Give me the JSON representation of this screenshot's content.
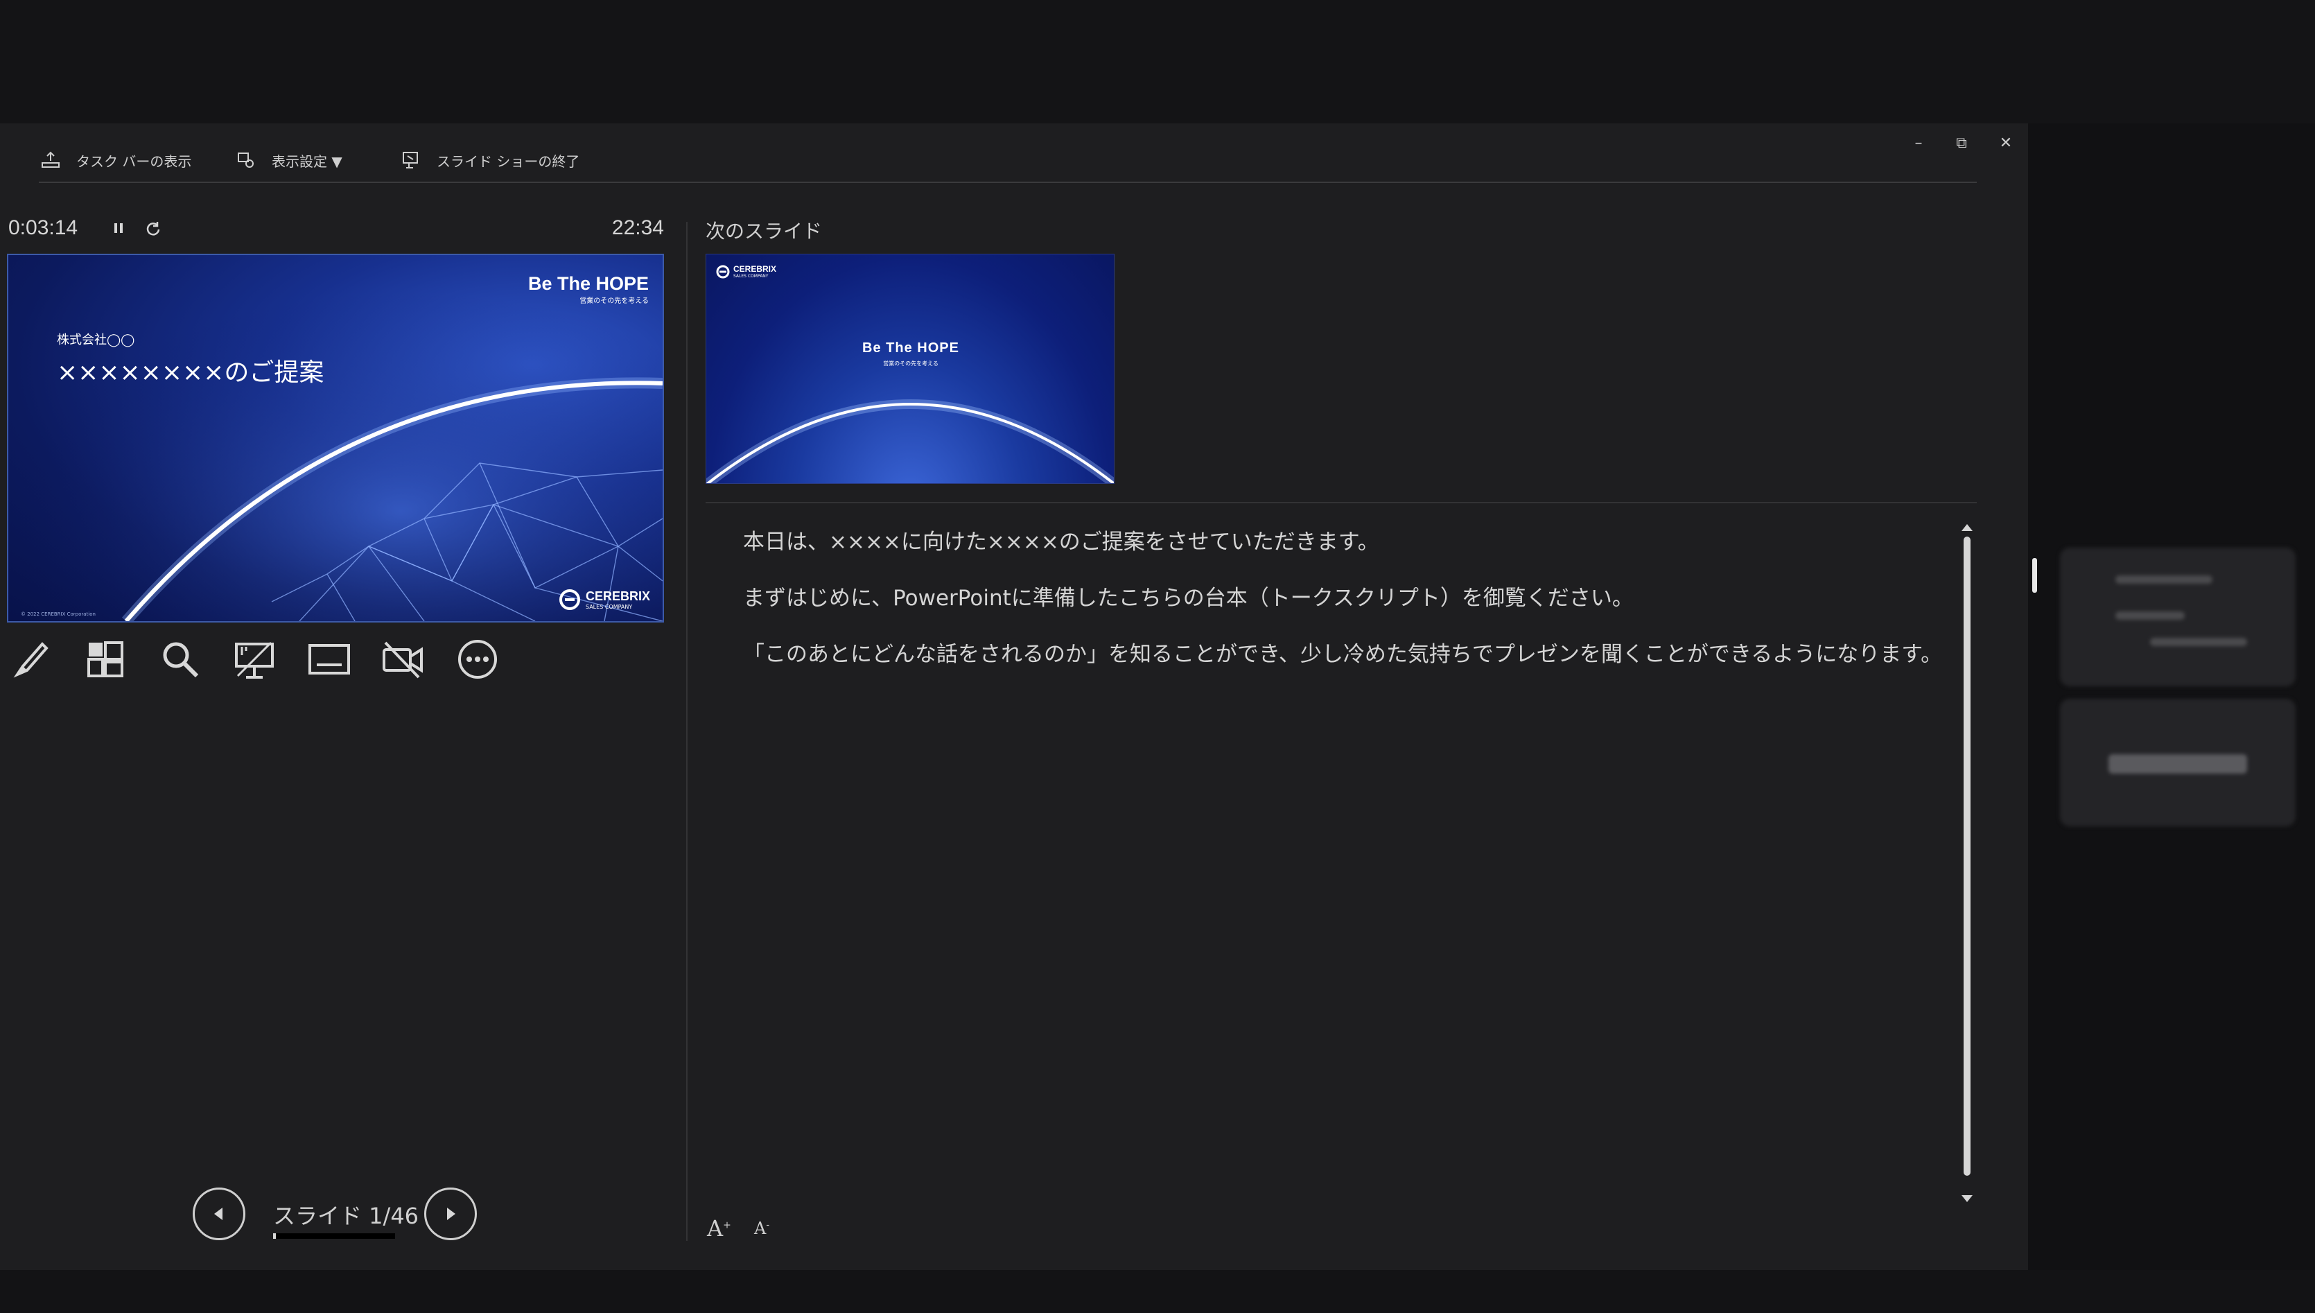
{
  "toolbar": {
    "taskbar_label": "タスク バーの表示",
    "display_settings_label": "表示設定 ▼",
    "end_show_label": "スライド ショーの終了"
  },
  "window_controls": {
    "minimize": "–",
    "restore": "⧉",
    "close": "✕"
  },
  "timer": {
    "elapsed": "0:03:14",
    "clock": "22:34"
  },
  "current_slide": {
    "logo_text": "Be The HOPE",
    "logo_sub": "営業のその先を考える",
    "company": "株式会社◯◯",
    "title": "××××××××のご提案",
    "brand": "CEREBRIX",
    "brand_sub": "SALES COMPANY",
    "copyright": "© 2022 CEREBRIX Corporation"
  },
  "tools": [
    "pen-icon",
    "slides-grid-icon",
    "zoom-icon",
    "pointer-icon",
    "subtitles-icon",
    "camera-off-icon",
    "more-icon"
  ],
  "navigation": {
    "slide_label": "スライド 1/46",
    "progress": 0.0217
  },
  "next_slide": {
    "label": "次のスライド",
    "brand": "CEREBRIX",
    "brand_sub": "SALES COMPANY",
    "title": "Be The HOPE",
    "subtitle": "営業のその先を考える"
  },
  "notes": {
    "line1": "本日は、××××に向けた××××のご提案をさせていただきます。",
    "line2": "まずはじめに、PowerPointに準備したこちらの台本（トークスクリプト）を御覧ください。",
    "line3": "「このあとにどんな話をされるのか」を知ることができ、少し冷めた気持ちでプレゼンを聞くことができるようになります。"
  },
  "font_controls": {
    "increase": "A",
    "decrease": "A"
  },
  "colors": {
    "window_bg": "#1e1e20",
    "slide_blue": "#17308f",
    "text": "#d4d4d4"
  }
}
